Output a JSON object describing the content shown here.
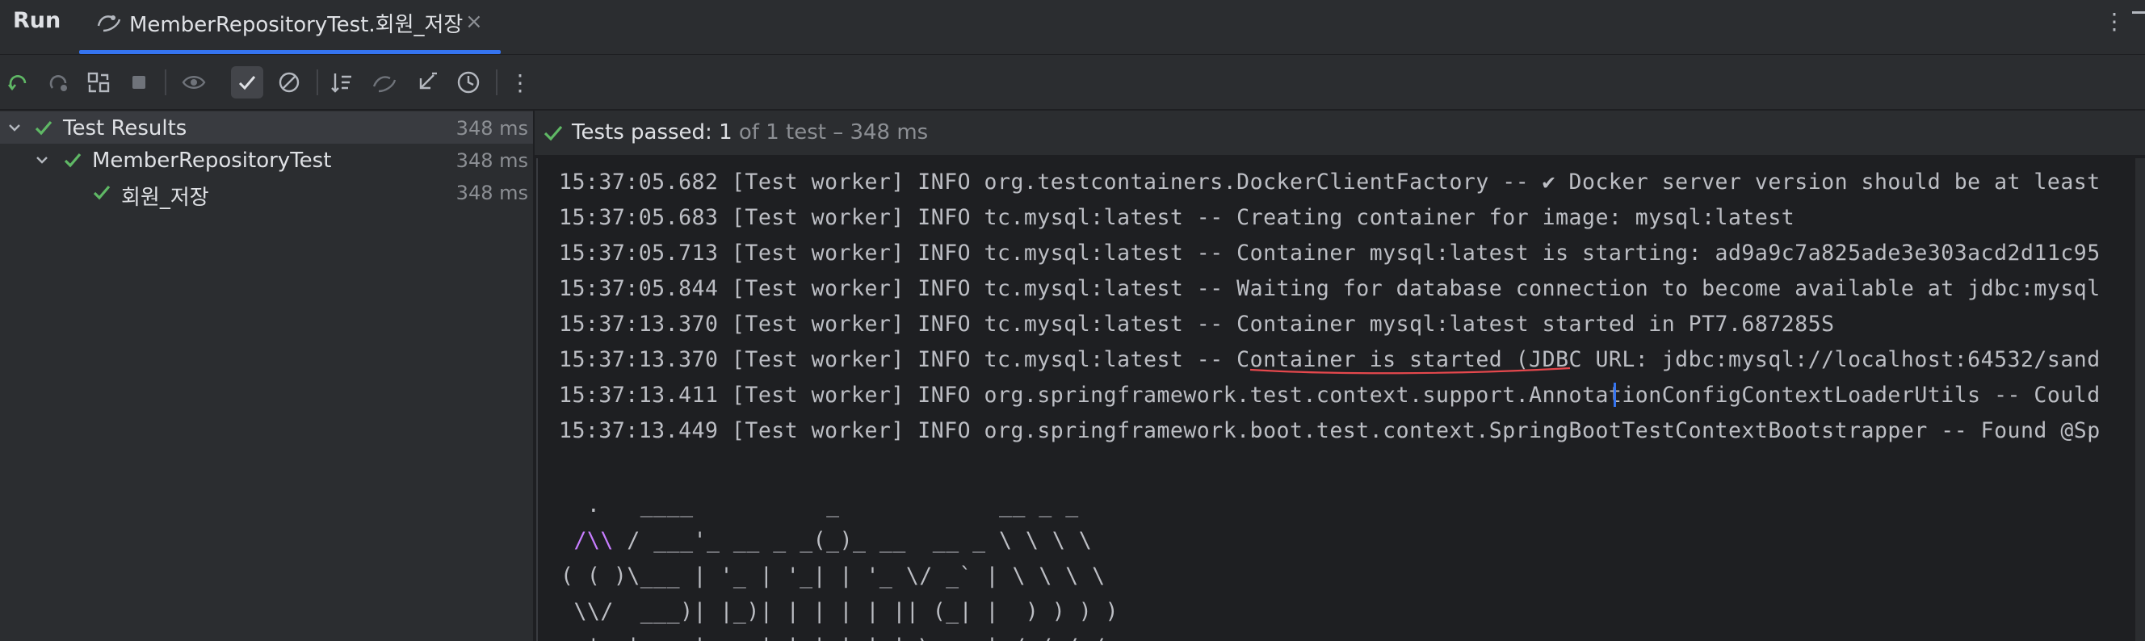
{
  "header": {
    "run_title": "Run",
    "tab_label": "MemberRepositoryTest.회원_저장",
    "tab_close": "×",
    "more": "⋮"
  },
  "toolbar": {
    "buttons": [
      {
        "name": "rerun-icon"
      },
      {
        "name": "rerun-failed-icon"
      },
      {
        "name": "toggle-auto-test-icon"
      },
      {
        "name": "stop-icon"
      },
      {
        "name": "show-passed-eye-icon"
      },
      {
        "name": "show-passed-check-icon",
        "active": true
      },
      {
        "name": "show-ignored-icon"
      },
      {
        "name": "sort-icon"
      },
      {
        "name": "import-tests-icon"
      },
      {
        "name": "collapse-icon"
      },
      {
        "name": "history-icon"
      },
      {
        "name": "more-options-icon"
      }
    ],
    "more": "⋮"
  },
  "tree": {
    "items": [
      {
        "label": "Test Results",
        "time": "348 ms",
        "level": 0,
        "selected": true
      },
      {
        "label": "MemberRepositoryTest",
        "time": "348 ms",
        "level": 1,
        "selected": false
      },
      {
        "label": "회원_저장",
        "time": "348 ms",
        "level": 2,
        "selected": false
      }
    ]
  },
  "status": {
    "main": "Tests passed: 1",
    "sub": " of 1 test – 348 ms"
  },
  "console": {
    "lines": [
      "15:37:05.682 [Test worker] INFO org.testcontainers.DockerClientFactory -- ✔︎ Docker server version should be at least",
      "15:37:05.683 [Test worker] INFO tc.mysql:latest -- Creating container for image: mysql:latest",
      "15:37:05.713 [Test worker] INFO tc.mysql:latest -- Container mysql:latest is starting: ad9a9c7a825ade3e303acd2d11c95",
      "15:37:05.844 [Test worker] INFO tc.mysql:latest -- Waiting for database connection to become available at jdbc:mysql",
      "15:37:13.370 [Test worker] INFO tc.mysql:latest -- Container mysql:latest started in PT7.687285S",
      "15:37:13.370 [Test worker] INFO tc.mysql:latest -- Container is started (JDBC URL: jdbc:mysql://localhost:64532/sand",
      "15:37:13.411 [Test worker] INFO org.springframework.test.context.support.AnnotationConfigContextLoaderUtils -- Could",
      "15:37:13.449 [Test worker] INFO org.springframework.boot.test.context.SpringBootTestContextBootstrapper -- Found @Sp"
    ],
    "banner": [
      "  .   ____          _            __ _ _",
      " /\\\\ / ___'_ __ _ _(_)_ __  __ _ \\ \\ \\ \\",
      "( ( )\\___ | '_ | '_| | '_ \\/ _` | \\ \\ \\ \\",
      " \\\\/  ___)| |_)| | | | | || (_| |  ) ) ) )",
      "  '  |____| .__|_| |_|_| |_\\__, | / / / /"
    ]
  },
  "colors": {
    "accent": "#3574f0",
    "success": "#5fb865",
    "underline": "#e5484d",
    "banner_accent": "#c77dff"
  }
}
